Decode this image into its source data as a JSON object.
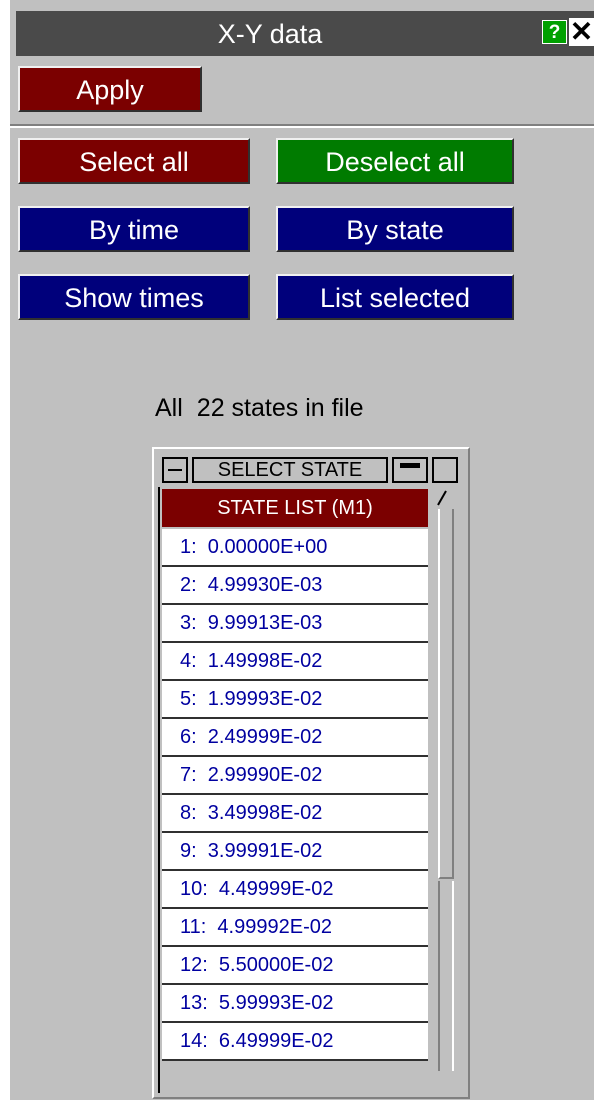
{
  "window": {
    "title": "X-Y data",
    "help_label": "?",
    "close_label": "✕"
  },
  "toolbar": {
    "apply_label": "Apply"
  },
  "buttons": {
    "select_all": "Select all",
    "deselect_all": "Deselect all",
    "by_time": "By time",
    "by_state": "By state",
    "show_times": "Show times",
    "list_selected": "List selected"
  },
  "summary": {
    "prefix": "All",
    "text": "22 states in file"
  },
  "state_list": {
    "select_label": "SELECT STATE",
    "header": "STATE LIST (M1)",
    "rows": [
      "1:  0.00000E+00",
      "2:  4.99930E-03",
      "3:  9.99913E-03",
      "4:  1.49998E-02",
      "5:  1.99993E-02",
      "6:  2.49999E-02",
      "7:  2.99990E-02",
      "8:  3.49998E-02",
      "9:  3.99991E-02",
      "10:  4.49999E-02",
      "11:  4.99992E-02",
      "12:  5.50000E-02",
      "13:  5.99993E-02",
      "14:  6.49999E-02"
    ]
  },
  "colors": {
    "panel_bg": "#c0c0c0",
    "title_bg": "#4a4a4a",
    "red": "#7b0000",
    "green": "#007b00",
    "blue": "#00007b",
    "row_text": "#0000a0"
  }
}
